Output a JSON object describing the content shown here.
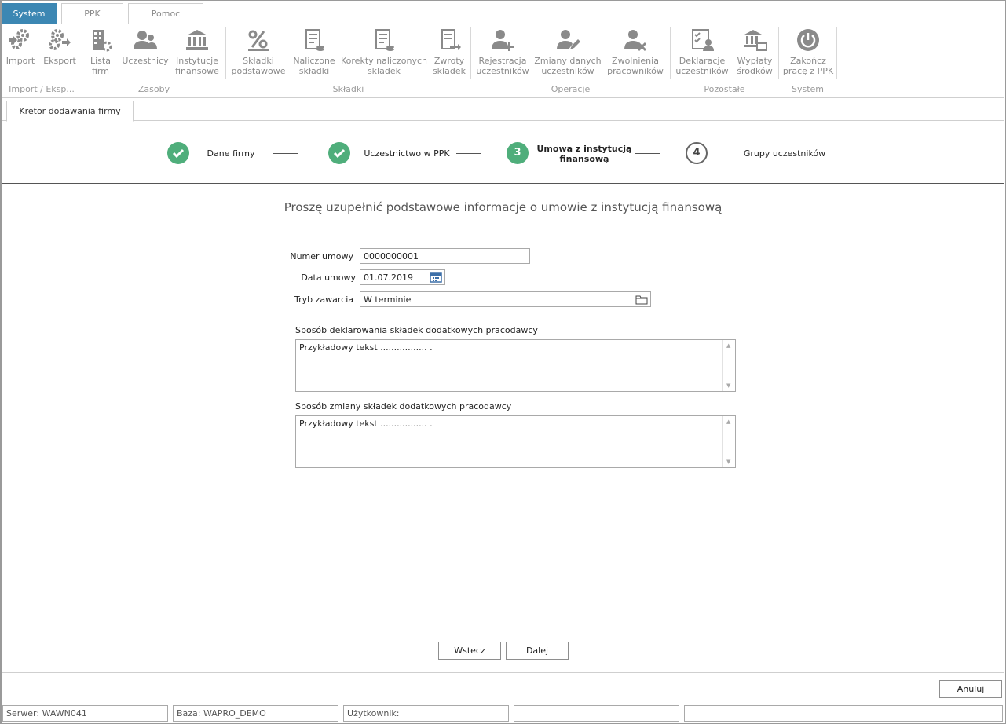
{
  "menu": {
    "tabs": [
      {
        "label": "System",
        "active": true
      },
      {
        "label": "PPK",
        "active": false
      },
      {
        "label": "Pomoc",
        "active": false
      }
    ]
  },
  "ribbon": {
    "buttons": {
      "import": [
        "Import",
        ""
      ],
      "export": [
        "Eksport",
        ""
      ],
      "companies": [
        "Lista",
        "firm"
      ],
      "participants": [
        "Uczestnicy",
        ""
      ],
      "institutions": [
        "Instytucje",
        "finansowe"
      ],
      "base_contrib": [
        "Składki",
        "podstawowe"
      ],
      "calc_contrib": [
        "Naliczone",
        "składki"
      ],
      "corrections": [
        "Korekty naliczonych",
        "składek"
      ],
      "refunds": [
        "Zwroty",
        "składek"
      ],
      "register": [
        "Rejestracja",
        "uczestników"
      ],
      "changes": [
        "Zmiany danych",
        "uczestników"
      ],
      "dismissals": [
        "Zwolnienia",
        "pracowników"
      ],
      "declarations": [
        "Deklaracje",
        "uczestników"
      ],
      "payouts": [
        "Wypłaty",
        "środków"
      ],
      "finish": [
        "Zakończ",
        "pracę z PPK"
      ]
    },
    "groups": {
      "import_export": "Import / Eksp...",
      "resources": "Zasoby",
      "contributions": "Składki",
      "operations": "Operacje",
      "other": "Pozostałe",
      "system": "System"
    }
  },
  "wizard_tab": {
    "label": "Kretor dodawania firmy"
  },
  "steps": [
    {
      "number": "1",
      "label": "Dane firmy",
      "state": "done"
    },
    {
      "number": "2",
      "label": "Uczestnictwo w PPK",
      "state": "done"
    },
    {
      "number": "3",
      "label_line1": "Umowa z instytucją",
      "label_line2": "finansową",
      "state": "current"
    },
    {
      "number": "4",
      "label": "Grupy uczestników",
      "state": "todo"
    }
  ],
  "form": {
    "heading": "Proszę uzupełnić podstawowe informacje o umowie z instytucją finansową",
    "contract_number": {
      "label": "Numer umowy",
      "value": "0000000001"
    },
    "contract_date": {
      "label": "Data umowy",
      "value": "01.07.2019"
    },
    "conclusion_mode": {
      "label": "Tryb zawarcia",
      "value": "W terminie"
    },
    "declaration_method": {
      "label": "Sposób deklarowania składek dodatkowych pracodawcy",
      "value": "Przykładowy tekst ................. ."
    },
    "change_method": {
      "label": "Sposób zmiany składek dodatkowych pracodawcy",
      "value": "Przykładowy tekst ................. ."
    }
  },
  "buttons": {
    "back": "Wstecz",
    "next": "Dalej",
    "cancel": "Anuluj"
  },
  "status_bar": {
    "server": "Serwer: WAWN041",
    "database": "Baza: WAPRO_DEMO",
    "user": "Użytkownik:",
    "cell4": "",
    "cell5": ""
  },
  "colors": {
    "accent": "#3c87b3",
    "step_done": "#4fae7b"
  }
}
